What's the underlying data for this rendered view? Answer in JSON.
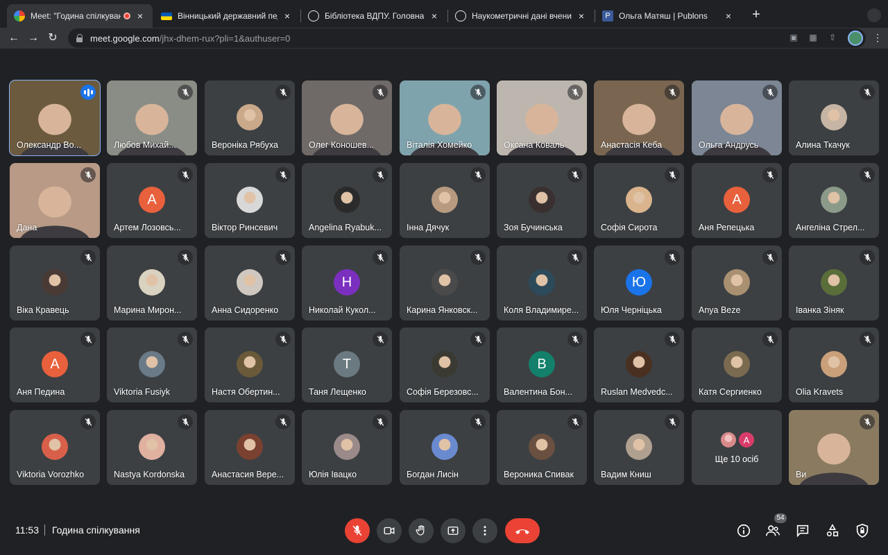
{
  "browser": {
    "tabs": [
      {
        "title": "Meet: \"Година спілкуванн",
        "favicon": "meet-icon",
        "active": true
      },
      {
        "title": "Вінницький державний педаг",
        "favicon": "ukraine-flag-icon",
        "active": false
      },
      {
        "title": "Бібліотека ВДПУ. Головна сто",
        "favicon": "globe-icon",
        "active": false
      },
      {
        "title": "Наукометричні дані вчених у",
        "favicon": "globe-icon",
        "active": false
      },
      {
        "title": "Ольга Матяш | Publons",
        "favicon": "publons-icon",
        "active": false
      }
    ],
    "url_host": "meet.google.com",
    "url_path": "/jhx-dhem-rux?pli=1&authuser=0"
  },
  "participants": [
    {
      "name": "Олександр Во...",
      "type": "video",
      "speaking": true,
      "bg": "#6b5a3e"
    },
    {
      "name": "Любов Михай...",
      "type": "video",
      "bg": "#8a8d86"
    },
    {
      "name": "Вероніка Рябуха",
      "type": "photo",
      "bg": "#c9a98a"
    },
    {
      "name": "Олег Коношев...",
      "type": "video",
      "bg": "#6f6a68"
    },
    {
      "name": "Віталія Хомейко",
      "type": "video",
      "bg": "#7fa3ad"
    },
    {
      "name": "Оксана Коваль",
      "type": "video",
      "bg": "#bdb6ae"
    },
    {
      "name": "Анастасія Кеба",
      "type": "video",
      "bg": "#7a6650"
    },
    {
      "name": "Ольга Андрусь",
      "type": "video",
      "bg": "#7c8694"
    },
    {
      "name": "Алина Ткачук",
      "type": "photo",
      "bg": "#c6b5a4"
    },
    {
      "name": "Дана",
      "type": "video",
      "bg": "#b89a86"
    },
    {
      "name": "Артем Лозовсь...",
      "type": "letter",
      "letter": "А",
      "color": "#e8613c"
    },
    {
      "name": "Віктор Ринсевич",
      "type": "photo",
      "bg": "#d8d8d8"
    },
    {
      "name": "Angelina Ryabuk...",
      "type": "photo",
      "bg": "#2b2b2b"
    },
    {
      "name": "Інна Дячук",
      "type": "photo",
      "bg": "#b79a80"
    },
    {
      "name": "Зоя Бучинська",
      "type": "photo",
      "bg": "#3a3030"
    },
    {
      "name": "Софія Сирота",
      "type": "photo",
      "bg": "#d9b48c"
    },
    {
      "name": "Аня Репецька",
      "type": "letter",
      "letter": "А",
      "color": "#e8613c"
    },
    {
      "name": "Ангеліна Стрел...",
      "type": "photo",
      "bg": "#8c9a8a"
    },
    {
      "name": "Віка Кравець",
      "type": "photo",
      "bg": "#4a3a36"
    },
    {
      "name": "Марина Мирон...",
      "type": "photo",
      "bg": "#d9d2c0"
    },
    {
      "name": "Анна Сидоренко",
      "type": "photo",
      "bg": "#cfc8c0"
    },
    {
      "name": "Николай Кукол...",
      "type": "letter",
      "letter": "Н",
      "color": "#7b2fbf"
    },
    {
      "name": "Карина Янковск...",
      "type": "photo",
      "bg": "#4a4a4a"
    },
    {
      "name": "Коля Владимире...",
      "type": "photo",
      "bg": "#2c4a5a"
    },
    {
      "name": "Юля Черніцька",
      "type": "letter",
      "letter": "Ю",
      "color": "#1a73e8"
    },
    {
      "name": "Anya Beze",
      "type": "photo",
      "bg": "#a99070"
    },
    {
      "name": "Іванка Зіняк",
      "type": "photo",
      "bg": "#5a6e3a"
    },
    {
      "name": "Аня Педина",
      "type": "letter",
      "letter": "А",
      "color": "#e8613c"
    },
    {
      "name": "Viktoria Fusiyk",
      "type": "photo",
      "bg": "#6a7a86"
    },
    {
      "name": "Настя Обертин...",
      "type": "photo",
      "bg": "#6a5a3a"
    },
    {
      "name": "Таня Лещенко",
      "type": "letter",
      "letter": "Т",
      "color": "#6b7a80"
    },
    {
      "name": "Софія Березовс...",
      "type": "photo",
      "bg": "#3a3a32"
    },
    {
      "name": "Валентина Бон...",
      "type": "letter",
      "letter": "В",
      "color": "#12806a"
    },
    {
      "name": "Ruslan Medvedc...",
      "type": "photo",
      "bg": "#4a3020"
    },
    {
      "name": "Катя Сергиенко",
      "type": "photo",
      "bg": "#7a6a50"
    },
    {
      "name": "Olia Kravets",
      "type": "photo",
      "bg": "#c9a07a"
    },
    {
      "name": "Viktoria Vorozhko",
      "type": "photo",
      "bg": "#d8604a"
    },
    {
      "name": "Nastya Kordonska",
      "type": "photo",
      "bg": "#e0b0a0"
    },
    {
      "name": "Анастасия Вере...",
      "type": "photo",
      "bg": "#7a4030"
    },
    {
      "name": "Юлія Івацко",
      "type": "photo",
      "bg": "#9a8a8a"
    },
    {
      "name": "Богдан Лисін",
      "type": "photo",
      "bg": "#6a8ad0"
    },
    {
      "name": "Вероника Спивак",
      "type": "photo",
      "bg": "#6a5040"
    },
    {
      "name": "Вадим Книш",
      "type": "photo",
      "bg": "#b0a090"
    },
    {
      "name": "Ще 10 осіб",
      "type": "more",
      "letter": "А"
    },
    {
      "name": "Ви",
      "type": "self",
      "bg": "#8a7a60"
    }
  ],
  "meeting": {
    "time": "11:53",
    "title": "Година спілкування",
    "participant_count": "54"
  },
  "controls": {
    "mic": "mic-off-icon",
    "camera": "camera-icon",
    "hand": "raise-hand-icon",
    "present": "present-screen-icon",
    "more": "more-options-icon",
    "leave": "end-call-icon"
  },
  "colors": {
    "background": "#202124",
    "tile": "#3c4043",
    "danger": "#ea4335",
    "accent": "#1a73e8"
  }
}
